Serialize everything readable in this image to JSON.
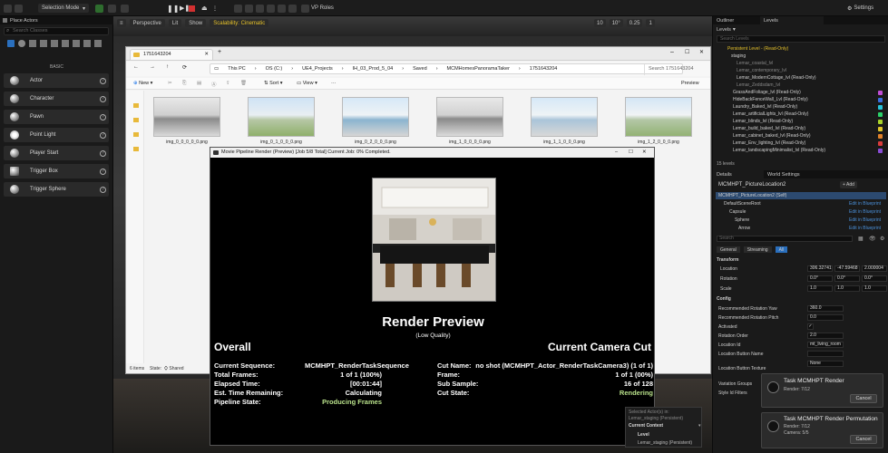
{
  "toolbar": {
    "selection_mode": "Selection Mode",
    "perspective": "Perspective",
    "lit": "Lit",
    "show": "Show",
    "scalability": "Scalability: Cinematic",
    "vp_roles": "VP Roles",
    "settings": "Settings",
    "grid_value": "10",
    "angle_value": "10°",
    "scale_value": "0.25",
    "cam_speed": "1"
  },
  "place_actors": {
    "title": "Place Actors",
    "search_placeholder": "Search Classes",
    "category": "BASIC",
    "items": [
      "Actor",
      "Character",
      "Pawn",
      "Point Light",
      "Player Start",
      "Trigger Box",
      "Trigger Sphere"
    ]
  },
  "explorer": {
    "tab_title": "1751643204",
    "breadcrumb": [
      "This PC",
      "OS (C:)",
      "UE4_Projects",
      "IH_03_Prod_5_04",
      "Saved",
      "MCMHomesPanoramaTaker",
      "1751643204"
    ],
    "search_placeholder": "Search 1751643204",
    "new_label": "New",
    "sort_label": "Sort",
    "view_label": "View",
    "preview_label": "Preview",
    "files": [
      "img_0_0_0_0_0.png",
      "img_0_1_0_0_0.png",
      "img_0_2_0_0_0.png",
      "img_1_0_0_0_0.png",
      "img_1_1_0_0_0.png",
      "img_1_2_0_0_0.png"
    ],
    "status_items": "6 items",
    "status_state": "State:",
    "status_shared": "Shared"
  },
  "render": {
    "window_title": "Movie Pipeline Render (Preview) [Job 5/8 Total] Current Job: 0% Completed.",
    "heading": "Render Preview",
    "quality": "(Low Quality)",
    "overall_title": "Overall",
    "cut_title": "Current Camera Cut",
    "overall": [
      {
        "label": "Current Sequence:",
        "value": "MCMHPT_RenderTaskSequence"
      },
      {
        "label": "Total Frames:",
        "value": "1 of 1 (100%)"
      },
      {
        "label": "Elapsed Time:",
        "value": "[00:01:44]"
      },
      {
        "label": "Est. Time Remaining:",
        "value": "Calculating"
      },
      {
        "label": "Pipeline State:",
        "value": "Producing Frames"
      }
    ],
    "cut": [
      {
        "label": "Cut Name:",
        "value": "no shot (MCMHPT_Actor_RenderTaskCamera3) (1 of 1)"
      },
      {
        "label": "Frame:",
        "value": "1 of 1 (00%)"
      },
      {
        "label": "Sub Sample:",
        "value": "16 of 128"
      },
      {
        "label": "Cut State:",
        "value": "Rendering"
      }
    ]
  },
  "outliner": {
    "tab_outliner": "Outliner",
    "tab_levels": "Levels",
    "levels_dropdown": "Levels",
    "search_placeholder": "Search Levels",
    "rows": [
      "Persistent Level - (Read-Only)",
      "staging",
      "Lemar_coastal_lvl",
      "Lemar_contemporary_lvl",
      "Lemar_ModernCottage_lvl (Read-Only)",
      "Lemar_Zeddsdam_lvl",
      "GrassAndFoliage_lvl (Read-Only)",
      "HideBackFenceWall_Lvl (Read-Only)",
      "Laundry_Baked_lvl (Read-Only)",
      "Lemar_artificialLights_lvl (Read-Only)",
      "Lemar_blinds_lvl (Read-Only)",
      "Lemar_build_baked_lvl (Read-Only)",
      "Lemar_cabinet_baked_lvl (Read-Only)",
      "Lemar_Env_lighting_lvl (Read-Only)",
      "Lemar_landscapingMinimalist_lvl (Read-Only)"
    ],
    "swatches": [
      "#c14dd6",
      "#3a6ee0",
      "#27c3d9",
      "#2bd16a",
      "#a8d42a",
      "#e0c52a",
      "#e0812a",
      "#d93c3c",
      "#8a4dd6"
    ],
    "level_count": "15 levels"
  },
  "details": {
    "tab_details": "Details",
    "tab_world": "World Settings",
    "actor_name": "MCMHPT_PictureLocation2",
    "add_label": "+ Add",
    "tree": [
      {
        "label": "MCMHPT_PictureLocation2 (Self)",
        "action": ""
      },
      {
        "label": "DefaultSceneRoot",
        "action": "Edit in Blueprint"
      },
      {
        "label": "Capsule",
        "action": "Edit in Blueprint"
      },
      {
        "label": "Sphere",
        "action": "Edit in Blueprint"
      },
      {
        "label": "Arrow",
        "action": "Edit in Blueprint"
      }
    ],
    "search_placeholder": "Search",
    "filters": [
      "General",
      "Streaming",
      "All"
    ],
    "section_transform": "Transform",
    "location_label": "Location",
    "location": [
      "306.32741",
      "-47.59468",
      "2.000004"
    ],
    "rotation_label": "Rotation",
    "rotation": [
      "0.0°",
      "0.0°",
      "0.0°"
    ],
    "scale_label": "Scale",
    "scale": [
      "1.0",
      "1.0",
      "1.0"
    ],
    "section_config": "Config",
    "props": [
      {
        "label": "Recommended Rotation Yaw",
        "value": "360.0"
      },
      {
        "label": "Recommended Rotation Pitch",
        "value": "0.0"
      },
      {
        "label": "Activated",
        "value": ""
      },
      {
        "label": "Rotation Order",
        "value": "2.0"
      },
      {
        "label": "Location Id",
        "value": "mt_living_room"
      },
      {
        "label": "Location Button Name",
        "value": ""
      },
      {
        "label": "Location Button Texture",
        "value": "None"
      }
    ],
    "groups": [
      "Variation Groups",
      "Style Id Filters"
    ]
  },
  "toasts": [
    {
      "title": "Task MCMHPT Render",
      "lines": [
        "Render: 7/12"
      ],
      "cancel": "Cancel"
    },
    {
      "title": "Task MCMHPT Render Permutation",
      "lines": [
        "Render: 7/12",
        "Camera: 5/5"
      ],
      "cancel": "Cancel"
    }
  ],
  "context": {
    "selected": "Selected Actor(s) in:",
    "staging": "Lemar_staging (Persistent)",
    "title": "Current Context",
    "level_label": "Level",
    "level_value": "Lemar_staging (Persistent)"
  }
}
